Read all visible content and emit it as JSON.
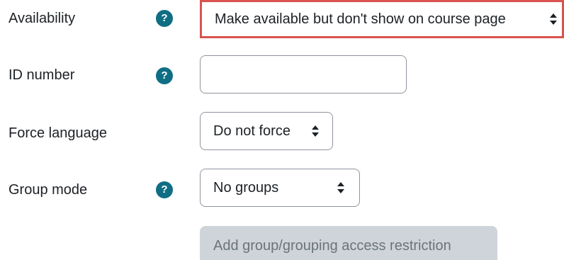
{
  "form": {
    "availability": {
      "label": "Availability",
      "help_icon": "question-mark-icon",
      "help_glyph": "?",
      "value": "Make available but don't show on course page",
      "highlight_color": "#d9534f"
    },
    "id_number": {
      "label": "ID number",
      "help_icon": "question-mark-icon",
      "help_glyph": "?",
      "value": "",
      "placeholder": ""
    },
    "force_language": {
      "label": "Force language",
      "value": "Do not force"
    },
    "group_mode": {
      "label": "Group mode",
      "help_icon": "question-mark-icon",
      "help_glyph": "?",
      "value": "No groups"
    },
    "add_restriction_button": {
      "label": "Add group/grouping access restriction",
      "disabled": true
    }
  },
  "colors": {
    "help_icon_bg": "#0f6e84",
    "text": "#1d2125",
    "field_border": "#8f959e",
    "disabled_button_bg": "#ced4da",
    "disabled_button_text": "#6a737b"
  }
}
